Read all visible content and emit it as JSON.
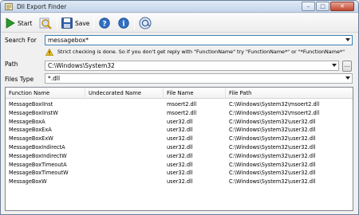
{
  "window": {
    "title": "Dll Export Finder"
  },
  "toolbar": {
    "start_label": "Start",
    "save_label": "Save"
  },
  "search": {
    "label": "Search For",
    "value": "messagebox*"
  },
  "warning": {
    "text": "Strict checking is done. So if you don't get reply with \"FunctionName\" try \"FunctionName*\" or \"*FunctionName*\""
  },
  "path": {
    "label": "Path",
    "value": "C:\\Windows\\System32",
    "browse_label": "..."
  },
  "filetype": {
    "label": "Files Type",
    "value": "*.dll"
  },
  "table": {
    "columns": [
      "Function Name",
      "Undecorated Name",
      "File Name",
      "File Path"
    ],
    "rows": [
      [
        "MessageBoxIInst",
        "",
        "msoert2.dll",
        "C:\\Windows\\System32\\msoert2.dll"
      ],
      [
        "MessageBoxIInstW",
        "",
        "msoert2.dll",
        "C:\\Windows\\System32\\msoert2.dll"
      ],
      [
        "MessageBoxA",
        "",
        "user32.dll",
        "C:\\Windows\\System32\\user32.dll"
      ],
      [
        "MessageBoxExA",
        "",
        "user32.dll",
        "C:\\Windows\\System32\\user32.dll"
      ],
      [
        "MessageBoxExW",
        "",
        "user32.dll",
        "C:\\Windows\\System32\\user32.dll"
      ],
      [
        "MessageBoxIndirectA",
        "",
        "user32.dll",
        "C:\\Windows\\System32\\user32.dll"
      ],
      [
        "MessageBoxIndirectW",
        "",
        "user32.dll",
        "C:\\Windows\\System32\\user32.dll"
      ],
      [
        "MessageBoxTimeoutA",
        "",
        "user32.dll",
        "C:\\Windows\\System32\\user32.dll"
      ],
      [
        "MessageBoxTimeoutW",
        "",
        "user32.dll",
        "C:\\Windows\\System32\\user32.dll"
      ],
      [
        "MessageBoxW",
        "",
        "user32.dll",
        "C:\\Windows\\System32\\user32.dll"
      ]
    ]
  },
  "icons": {
    "app": "app-icon",
    "start": "play-icon",
    "find": "find-icon",
    "save": "save-icon",
    "help": "help-icon",
    "info": "info-icon",
    "web": "web-icon",
    "warning": "warning-icon"
  },
  "colors": {
    "start_green": "#2a9a2a",
    "save_blue": "#2d5fa8",
    "help_blue": "#2f6fc4",
    "warning_yellow": "#f5c518",
    "search_focus": "#3c7fb1",
    "close_red": "#c2472f"
  }
}
